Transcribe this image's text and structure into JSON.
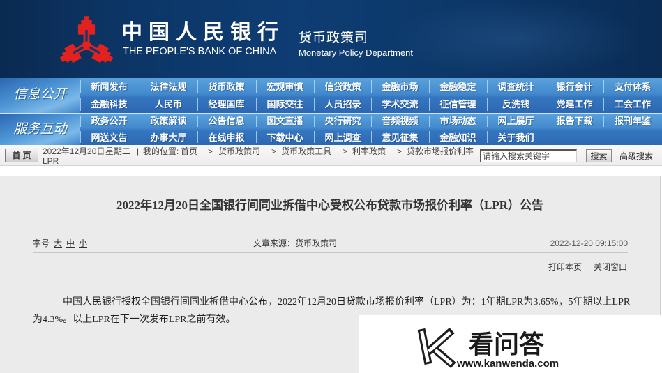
{
  "header": {
    "bank_name_cn": "中国人民银行",
    "bank_name_en": "THE PEOPLE'S BANK OF CHINA",
    "dept_name_cn": "货币政策司",
    "dept_name_en": "Monetary Policy Department",
    "logo_icon": "pboc-emblem-icon"
  },
  "nav": {
    "groups": [
      {
        "label": "信息公开",
        "rows": [
          [
            "新闻发布",
            "法律法规",
            "货币政策",
            "宏观审慎",
            "信贷政策",
            "金融市场",
            "金融稳定",
            "调查统计",
            "银行会计",
            "支付体系"
          ],
          [
            "金融科技",
            "人民币",
            "经理国库",
            "国际交往",
            "人员招录",
            "学术交流",
            "征信管理",
            "反洗钱",
            "党建工作",
            "工会工作"
          ]
        ]
      },
      {
        "label": "服务互动",
        "rows": [
          [
            "政务公开",
            "政策解读",
            "公告信息",
            "图文直播",
            "央行研究",
            "音频视频",
            "市场动态",
            "网上展厅",
            "报告下载",
            "报刊年鉴"
          ],
          [
            "网送文告",
            "办事大厅",
            "在线申报",
            "下载中心",
            "网上调查",
            "意见征集",
            "金融知识",
            "关于我们"
          ]
        ]
      }
    ]
  },
  "breadcrumb_bar": {
    "home_button": "首 页",
    "date": "2022年12月20日",
    "weekday": "星期二",
    "divider": "|",
    "location_label": "我的位置:",
    "crumb_separator": ">",
    "crumbs": [
      "首页",
      "货币政策司",
      "货币政策工具",
      "利率政策",
      "贷款市场报价利率LPR"
    ],
    "search_placeholder": "请输入搜索关键字",
    "search_button": "搜索",
    "advanced_search": "高级搜索"
  },
  "article": {
    "title": "2022年12月20日全国银行间同业拆借中心受权公布贷款市场报价利率（LPR）公告",
    "font_size_label": "字号",
    "font_sizes": [
      "大",
      "中",
      "小"
    ],
    "source": "文章来源：货币政策司",
    "datetime": "2022-12-20 09:15:00",
    "print_link": "打印本页",
    "close_link": "关闭窗口",
    "body": "中国人民银行授权全国银行间同业拆借中心公布，2022年12月20日贷款市场报价利率（LPR）为：1年期LPR为3.65%，5年期以上LPR为4.3%。以上LPR在下一次发布LPR之前有效。",
    "lpr_1y": "3.65%",
    "lpr_5y_plus": "4.3%"
  },
  "watermark": {
    "logo_icon": "kanwenda-k-logo-icon",
    "name": "看问答",
    "url": "www.kanwenda.com"
  },
  "colors": {
    "header_bg": "#0d3a6e",
    "nav_blue": "#3a7ec6",
    "logo_red": "#e3221f",
    "content_bg": "#ebebeb",
    "text": "#333333"
  }
}
